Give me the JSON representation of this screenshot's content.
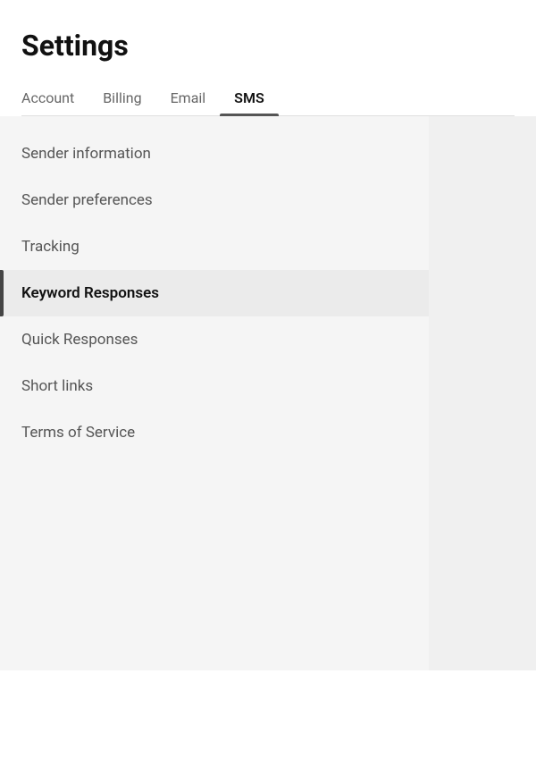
{
  "page": {
    "title": "Settings"
  },
  "tabs": {
    "items": [
      {
        "id": "account",
        "label": "Account",
        "active": false
      },
      {
        "id": "billing",
        "label": "Billing",
        "active": false
      },
      {
        "id": "email",
        "label": "Email",
        "active": false
      },
      {
        "id": "sms",
        "label": "SMS",
        "active": true
      }
    ]
  },
  "sidebar": {
    "items": [
      {
        "id": "sender-information",
        "label": "Sender information",
        "active": false
      },
      {
        "id": "sender-preferences",
        "label": "Sender preferences",
        "active": false
      },
      {
        "id": "tracking",
        "label": "Tracking",
        "active": false
      },
      {
        "id": "keyword-responses",
        "label": "Keyword Responses",
        "active": true
      },
      {
        "id": "quick-responses",
        "label": "Quick Responses",
        "active": false
      },
      {
        "id": "short-links",
        "label": "Short links",
        "active": false
      },
      {
        "id": "terms-of-service",
        "label": "Terms of Service",
        "active": false
      }
    ]
  }
}
